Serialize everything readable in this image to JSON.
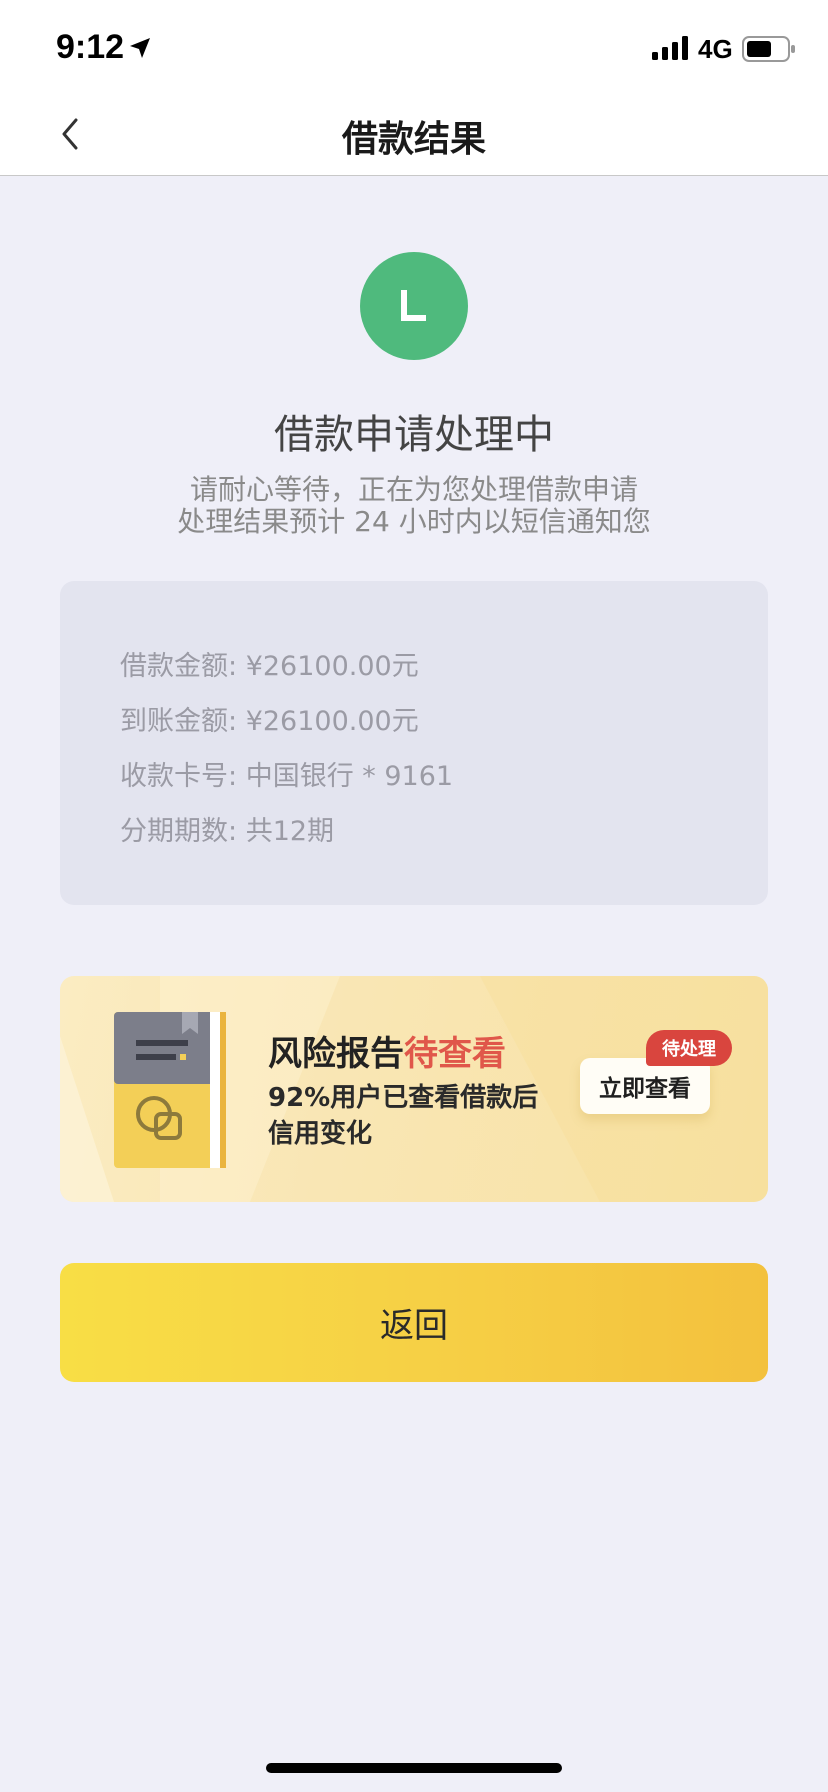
{
  "status_bar": {
    "time": "9:12",
    "network": "4G"
  },
  "nav": {
    "title": "借款结果"
  },
  "status": {
    "icon_letter": "L",
    "title": "借款申请处理中",
    "desc_line1": "请耐心等待，正在为您处理借款申请",
    "desc_line2": "处理结果预计 24 小时内以短信通知您"
  },
  "loan_info": {
    "rows": [
      {
        "label": "借款金额:",
        "value": "¥26100.00元"
      },
      {
        "label": "到账金额:",
        "value": "¥26100.00元"
      },
      {
        "label": "收款卡号:",
        "value": "中国银行 * 9161"
      },
      {
        "label": "分期期数:",
        "value": "共12期"
      }
    ]
  },
  "risk_report": {
    "title": "风险报告",
    "title_accent": "待查看",
    "desc": "92%用户已查看借款后信用变化",
    "button_label": "立即查看",
    "badge": "待处理"
  },
  "actions": {
    "return_label": "返回"
  },
  "colors": {
    "success_green": "#4fba7d",
    "accent_red": "#e0574a",
    "button_yellow": "#f6cf45",
    "background": "#efeff8"
  }
}
